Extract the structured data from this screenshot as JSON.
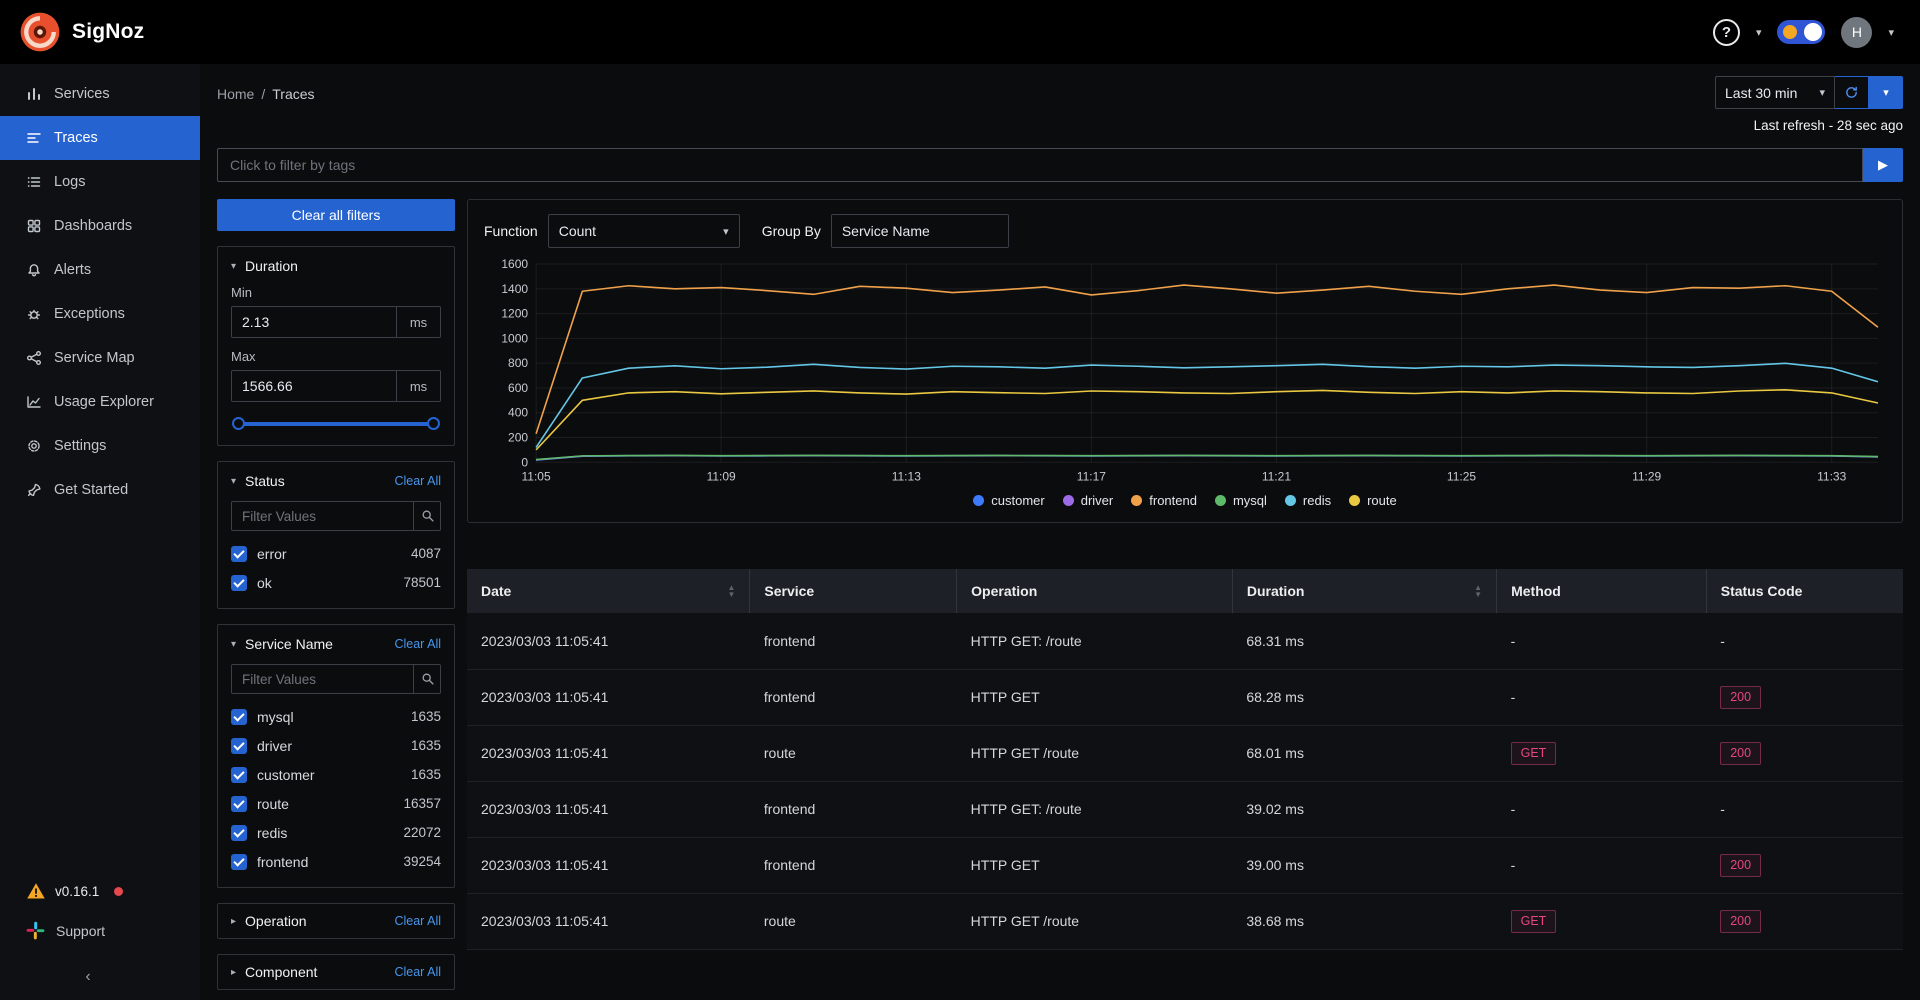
{
  "app": {
    "brand": "SigNoz"
  },
  "colors": {
    "accent": "#2563d0",
    "accent_bright": "#4696ec",
    "badge_pink": "#e5487e",
    "status_red": "#e5484d",
    "warning_orange": "#f5a623"
  },
  "icons": {
    "chevron_down": "▾",
    "chevron_right": "▸",
    "play": "▶",
    "collapse": "‹",
    "question": "?",
    "sort_asc": "▲",
    "sort_desc": "▼",
    "separator": "/"
  },
  "header": {
    "avatar_initial": "H"
  },
  "sidebar": {
    "items": [
      {
        "label": "Services",
        "icon": "bar-chart-icon",
        "active": false
      },
      {
        "label": "Traces",
        "icon": "traces-icon",
        "active": true
      },
      {
        "label": "Logs",
        "icon": "logs-icon",
        "active": false
      },
      {
        "label": "Dashboards",
        "icon": "dashboard-icon",
        "active": false
      },
      {
        "label": "Alerts",
        "icon": "alert-bell-icon",
        "active": false
      },
      {
        "label": "Exceptions",
        "icon": "bug-icon",
        "active": false
      },
      {
        "label": "Service Map",
        "icon": "service-map-icon",
        "active": false
      },
      {
        "label": "Usage Explorer",
        "icon": "usage-explorer-icon",
        "active": false
      },
      {
        "label": "Settings",
        "icon": "gear-icon",
        "active": false
      },
      {
        "label": "Get Started",
        "icon": "rocket-icon",
        "active": false
      }
    ],
    "version": "v0.16.1",
    "support_label": "Support"
  },
  "breadcrumb": {
    "home": "Home",
    "current": "Traces"
  },
  "time": {
    "range": "Last 30 min",
    "last_refresh": "Last refresh - 28 sec ago"
  },
  "search": {
    "placeholder": "Click to filter by tags"
  },
  "filters": {
    "clear_all_button": "Clear all filters",
    "duration": {
      "title": "Duration",
      "min_label": "Min",
      "min_value": "2.13",
      "max_label": "Max",
      "max_value": "1566.66",
      "unit": "ms"
    },
    "status": {
      "title": "Status",
      "clear_label": "Clear All",
      "placeholder": "Filter Values",
      "options": [
        {
          "label": "error",
          "count": "4087",
          "checked": true
        },
        {
          "label": "ok",
          "count": "78501",
          "checked": true
        }
      ]
    },
    "service": {
      "title": "Service Name",
      "clear_label": "Clear All",
      "placeholder": "Filter Values",
      "options": [
        {
          "label": "mysql",
          "count": "1635",
          "checked": true
        },
        {
          "label": "driver",
          "count": "1635",
          "checked": true
        },
        {
          "label": "customer",
          "count": "1635",
          "checked": true
        },
        {
          "label": "route",
          "count": "16357",
          "checked": true
        },
        {
          "label": "redis",
          "count": "22072",
          "checked": true
        },
        {
          "label": "frontend",
          "count": "39254",
          "checked": true
        }
      ]
    },
    "more": [
      {
        "title": "Operation",
        "clear_label": "Clear All"
      },
      {
        "title": "Component",
        "clear_label": "Clear All"
      }
    ]
  },
  "controls": {
    "function_label": "Function",
    "function_value": "Count",
    "group_by_label": "Group By",
    "group_by_value": "Service Name"
  },
  "chart_data": {
    "type": "line",
    "title": "",
    "xlabel": "",
    "ylabel": "",
    "ylim": [
      0,
      1600
    ],
    "yticks": [
      0,
      200,
      400,
      600,
      800,
      1000,
      1200,
      1400,
      1600
    ],
    "grid": true,
    "legend_position": "bottom",
    "x": [
      "11:05",
      "11:06",
      "11:07",
      "11:08",
      "11:09",
      "11:10",
      "11:11",
      "11:12",
      "11:13",
      "11:14",
      "11:15",
      "11:16",
      "11:17",
      "11:18",
      "11:19",
      "11:20",
      "11:21",
      "11:22",
      "11:23",
      "11:24",
      "11:25",
      "11:26",
      "11:27",
      "11:28",
      "11:29",
      "11:30",
      "11:31",
      "11:32",
      "11:33",
      "11:34"
    ],
    "xtick_indices": [
      0,
      4,
      8,
      12,
      16,
      20,
      24,
      28
    ],
    "series": [
      {
        "name": "customer",
        "color": "#3e7bfa",
        "values": [
          18,
          49,
          52,
          53,
          51,
          52,
          53,
          52,
          51,
          52,
          53,
          52,
          51,
          52,
          53,
          52,
          51,
          52,
          53,
          52,
          51,
          52,
          53,
          52,
          51,
          52,
          53,
          52,
          51,
          43
        ]
      },
      {
        "name": "driver",
        "color": "#9d6ae8",
        "values": [
          20,
          50,
          53,
          54,
          52,
          53,
          54,
          53,
          52,
          53,
          54,
          53,
          52,
          53,
          54,
          53,
          52,
          53,
          54,
          53,
          52,
          53,
          54,
          53,
          52,
          53,
          54,
          53,
          52,
          44
        ]
      },
      {
        "name": "frontend",
        "color": "#f0a24b",
        "values": [
          230,
          1380,
          1425,
          1400,
          1410,
          1385,
          1355,
          1420,
          1405,
          1370,
          1390,
          1415,
          1350,
          1385,
          1430,
          1400,
          1365,
          1390,
          1420,
          1380,
          1355,
          1400,
          1430,
          1390,
          1370,
          1410,
          1405,
          1425,
          1380,
          1090
        ]
      },
      {
        "name": "mysql",
        "color": "#5dba6a",
        "values": [
          22,
          52,
          54,
          55,
          53,
          54,
          55,
          54,
          53,
          54,
          55,
          54,
          53,
          54,
          55,
          54,
          53,
          54,
          55,
          54,
          53,
          54,
          55,
          54,
          53,
          54,
          55,
          54,
          53,
          46
        ]
      },
      {
        "name": "redis",
        "color": "#64c7e6",
        "values": [
          120,
          680,
          760,
          778,
          755,
          768,
          790,
          765,
          752,
          775,
          770,
          760,
          785,
          775,
          762,
          770,
          780,
          790,
          772,
          760,
          775,
          770,
          785,
          780,
          770,
          765,
          780,
          798,
          760,
          650
        ]
      },
      {
        "name": "route",
        "color": "#e9c842",
        "values": [
          100,
          500,
          560,
          570,
          553,
          565,
          576,
          560,
          550,
          570,
          562,
          555,
          575,
          570,
          560,
          555,
          570,
          580,
          565,
          555,
          570,
          560,
          576,
          570,
          560,
          555,
          575,
          585,
          560,
          478
        ]
      }
    ]
  },
  "table": {
    "columns": [
      {
        "label": "Date",
        "sortable": true
      },
      {
        "label": "Service",
        "sortable": false
      },
      {
        "label": "Operation",
        "sortable": false
      },
      {
        "label": "Duration",
        "sortable": true
      },
      {
        "label": "Method",
        "sortable": false
      },
      {
        "label": "Status Code",
        "sortable": false
      }
    ],
    "rows": [
      {
        "date": "2023/03/03 11:05:41",
        "service": "frontend",
        "operation": "HTTP GET: /route",
        "duration": "68.31 ms",
        "method": "-",
        "status_code": "-"
      },
      {
        "date": "2023/03/03 11:05:41",
        "service": "frontend",
        "operation": "HTTP GET",
        "duration": "68.28 ms",
        "method": "-",
        "status_code": "200"
      },
      {
        "date": "2023/03/03 11:05:41",
        "service": "route",
        "operation": "HTTP GET /route",
        "duration": "68.01 ms",
        "method": "GET",
        "status_code": "200"
      },
      {
        "date": "2023/03/03 11:05:41",
        "service": "frontend",
        "operation": "HTTP GET: /route",
        "duration": "39.02 ms",
        "method": "-",
        "status_code": "-"
      },
      {
        "date": "2023/03/03 11:05:41",
        "service": "frontend",
        "operation": "HTTP GET",
        "duration": "39.00 ms",
        "method": "-",
        "status_code": "200"
      },
      {
        "date": "2023/03/03 11:05:41",
        "service": "route",
        "operation": "HTTP GET /route",
        "duration": "38.68 ms",
        "method": "GET",
        "status_code": "200"
      }
    ]
  }
}
